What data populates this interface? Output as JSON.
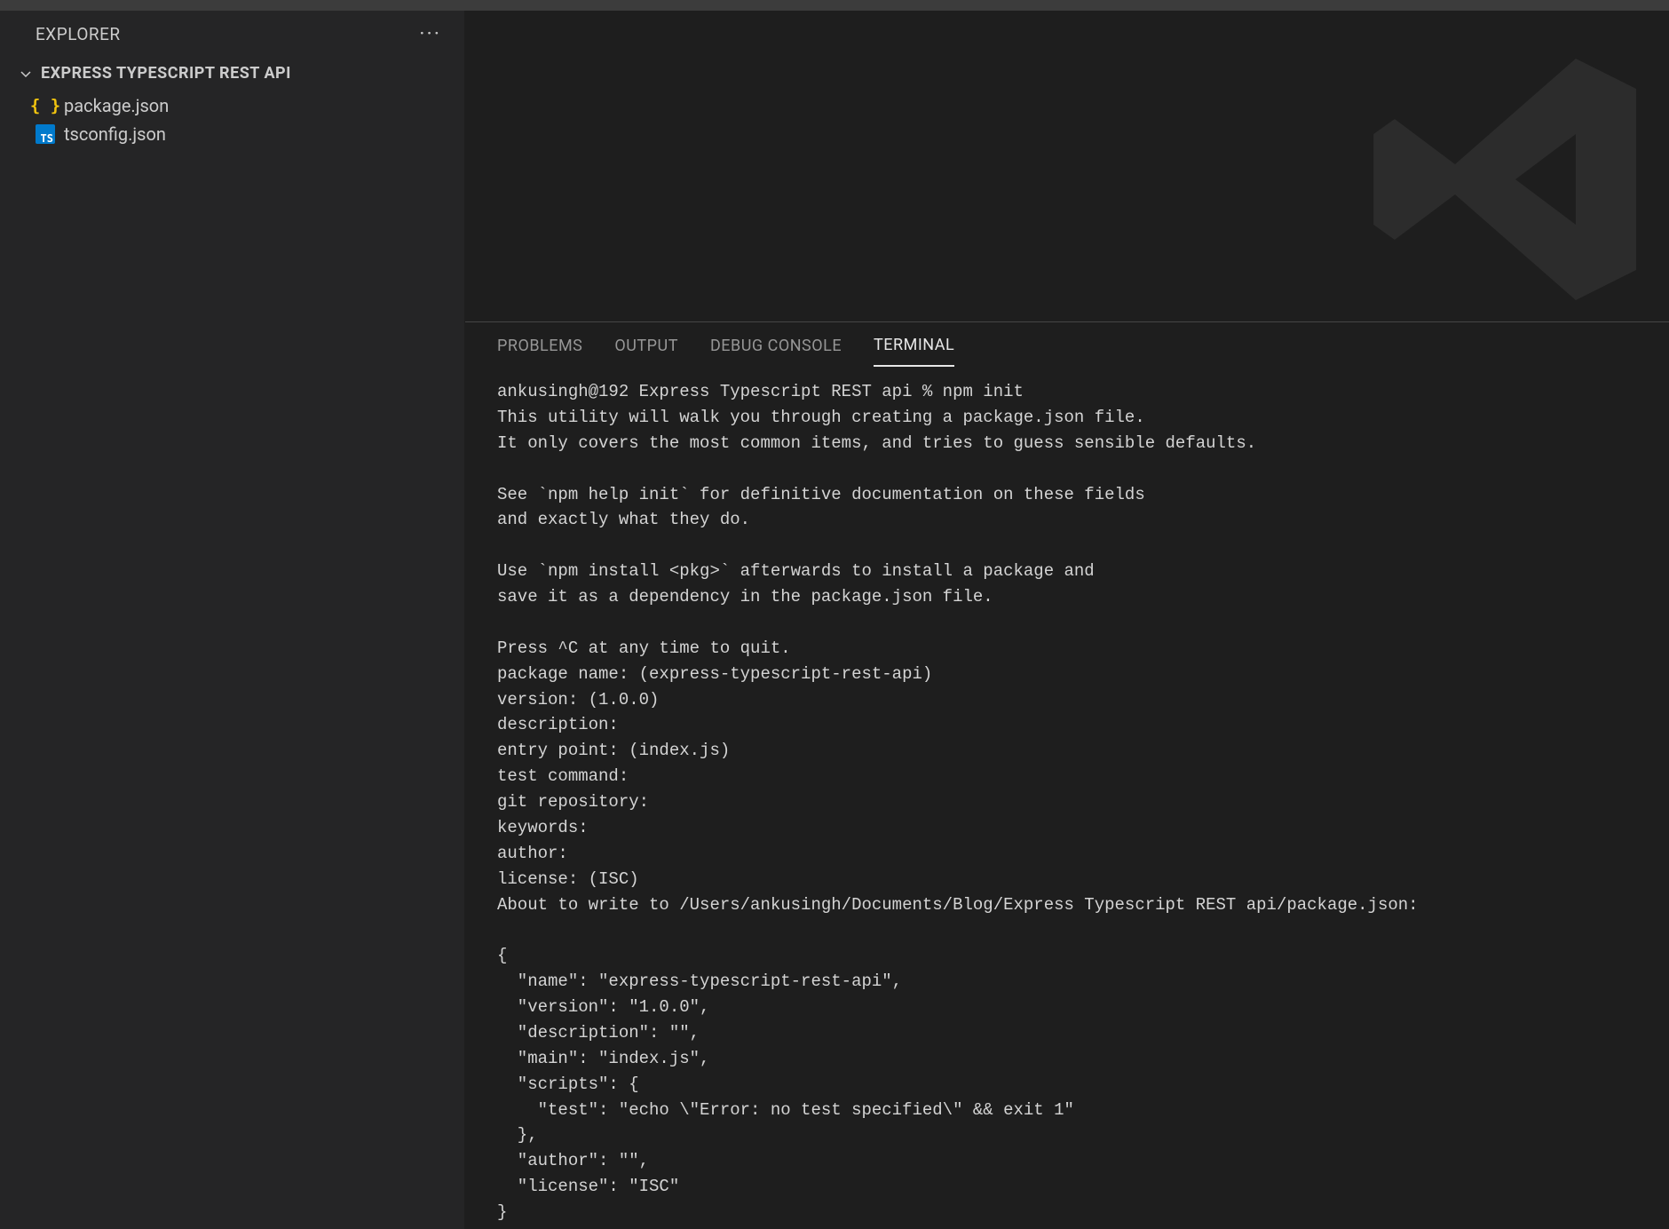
{
  "sidebar": {
    "title": "EXPLORER",
    "project": "EXPRESS TYPESCRIPT REST API",
    "files": [
      {
        "name": "package.json",
        "iconType": "json"
      },
      {
        "name": "tsconfig.json",
        "iconType": "ts"
      }
    ]
  },
  "panel": {
    "tabs": {
      "problems": "PROBLEMS",
      "output": "OUTPUT",
      "debug": "DEBUG CONSOLE",
      "terminal": "TERMINAL"
    },
    "activeTab": "terminal"
  },
  "terminal": {
    "content": "ankusingh@192 Express Typescript REST api % npm init\nThis utility will walk you through creating a package.json file.\nIt only covers the most common items, and tries to guess sensible defaults.\n\nSee `npm help init` for definitive documentation on these fields\nand exactly what they do.\n\nUse `npm install <pkg>` afterwards to install a package and\nsave it as a dependency in the package.json file.\n\nPress ^C at any time to quit.\npackage name: (express-typescript-rest-api) \nversion: (1.0.0) \ndescription: \nentry point: (index.js) \ntest command: \ngit repository: \nkeywords: \nauthor: \nlicense: (ISC) \nAbout to write to /Users/ankusingh/Documents/Blog/Express Typescript REST api/package.json:\n\n{\n  \"name\": \"express-typescript-rest-api\",\n  \"version\": \"1.0.0\",\n  \"description\": \"\",\n  \"main\": \"index.js\",\n  \"scripts\": {\n    \"test\": \"echo \\\"Error: no test specified\\\" && exit 1\"\n  },\n  \"author\": \"\",\n  \"license\": \"ISC\"\n}"
  }
}
